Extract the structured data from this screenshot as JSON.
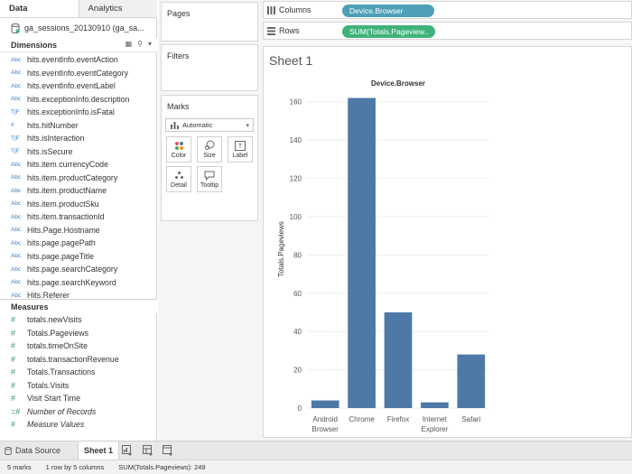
{
  "left_pane": {
    "tabs": [
      {
        "label": "Data"
      },
      {
        "label": "Analytics"
      }
    ],
    "datasource_label": "ga_sessions_20130910 (ga_sa...",
    "dimensions_header": "Dimensions",
    "measures_header": "Measures",
    "dimensions": [
      {
        "type_icon": "Abc",
        "label": "hits.eventInfo.eventAction"
      },
      {
        "type_icon": "Abc",
        "label": "hits.eventInfo.eventCategory"
      },
      {
        "type_icon": "Abc",
        "label": "hits.eventInfo.eventLabel"
      },
      {
        "type_icon": "Abc",
        "label": "hits.exceptionInfo.description"
      },
      {
        "type_icon": "T|F",
        "label": "hits.exceptionInfo.isFatal"
      },
      {
        "type_icon": "#",
        "label": "hits.hitNumber"
      },
      {
        "type_icon": "T|F",
        "label": "hits.isInteraction"
      },
      {
        "type_icon": "T|F",
        "label": "hits.isSecure"
      },
      {
        "type_icon": "Abc",
        "label": "hits.item.currencyCode"
      },
      {
        "type_icon": "Abc",
        "label": "hits.item.productCategory"
      },
      {
        "type_icon": "Abc",
        "label": "hits.item.productName"
      },
      {
        "type_icon": "Abc",
        "label": "hits.item.productSku"
      },
      {
        "type_icon": "Abc",
        "label": "hits.item.transactionId"
      },
      {
        "type_icon": "Abc",
        "label": "Hits.Page.Hostname"
      },
      {
        "type_icon": "Abc",
        "label": "hits.page.pagePath"
      },
      {
        "type_icon": "Abc",
        "label": "hits.page.pageTitle"
      },
      {
        "type_icon": "Abc",
        "label": "hits.page.searchCategory"
      },
      {
        "type_icon": "Abc",
        "label": "hits.page.searchKeyword"
      },
      {
        "type_icon": "Abc",
        "label": "Hits.Referer"
      }
    ],
    "measures": [
      {
        "type_icon": "#",
        "label": "totals.newVisits",
        "italic": false
      },
      {
        "type_icon": "#",
        "label": "Totals.Pageviews",
        "italic": false
      },
      {
        "type_icon": "#",
        "label": "totals.timeOnSite",
        "italic": false
      },
      {
        "type_icon": "#",
        "label": "totals.transactionRevenue",
        "italic": false
      },
      {
        "type_icon": "#",
        "label": "Totals.Transactions",
        "italic": false
      },
      {
        "type_icon": "#",
        "label": "Totals.Visits",
        "italic": false
      },
      {
        "type_icon": "#",
        "label": "Visit Start Time",
        "italic": false
      },
      {
        "type_icon": "=#",
        "label": "Number of Records",
        "italic": true
      },
      {
        "type_icon": "#",
        "label": "Measure Values",
        "italic": true
      }
    ]
  },
  "cards": {
    "pages": "Pages",
    "filters": "Filters",
    "marks": "Marks",
    "mark_type": "Automatic",
    "mark_buttons": [
      {
        "label": "Color"
      },
      {
        "label": "Size"
      },
      {
        "label": "Label"
      },
      {
        "label": "Detail"
      },
      {
        "label": "Tooltip"
      }
    ]
  },
  "shelves": {
    "columns_label": "Columns",
    "rows_label": "Rows",
    "columns_pill": "Device.Browser",
    "rows_pill": "SUM(Totals.Pageview.."
  },
  "sheet": {
    "title": "Sheet 1"
  },
  "chart_data": {
    "type": "bar",
    "title": "Device.Browser",
    "xlabel": "",
    "ylabel": "Totals.Pageviews",
    "categories": [
      "Android Browser",
      "Chrome",
      "Firefox",
      "Internet Explorer",
      "Safari"
    ],
    "category_lines": [
      [
        "Android",
        "Browser"
      ],
      [
        "Chrome"
      ],
      [
        "Firefox"
      ],
      [
        "Internet",
        "Explorer"
      ],
      [
        "Safari"
      ]
    ],
    "values": [
      4,
      162,
      50,
      3,
      28
    ],
    "ylim": [
      0,
      166
    ],
    "yticks": [
      0,
      20,
      40,
      60,
      80,
      100,
      120,
      140,
      160
    ],
    "grid": true,
    "bar_color": "#4e79a7"
  },
  "bottom_tabs": {
    "datasource": "Data Source",
    "sheet1": "Sheet 1"
  },
  "status": {
    "marks": "5 marks",
    "dims": "1 row by 5 columns",
    "sum": "SUM(Totals.Pageviews): 249"
  }
}
